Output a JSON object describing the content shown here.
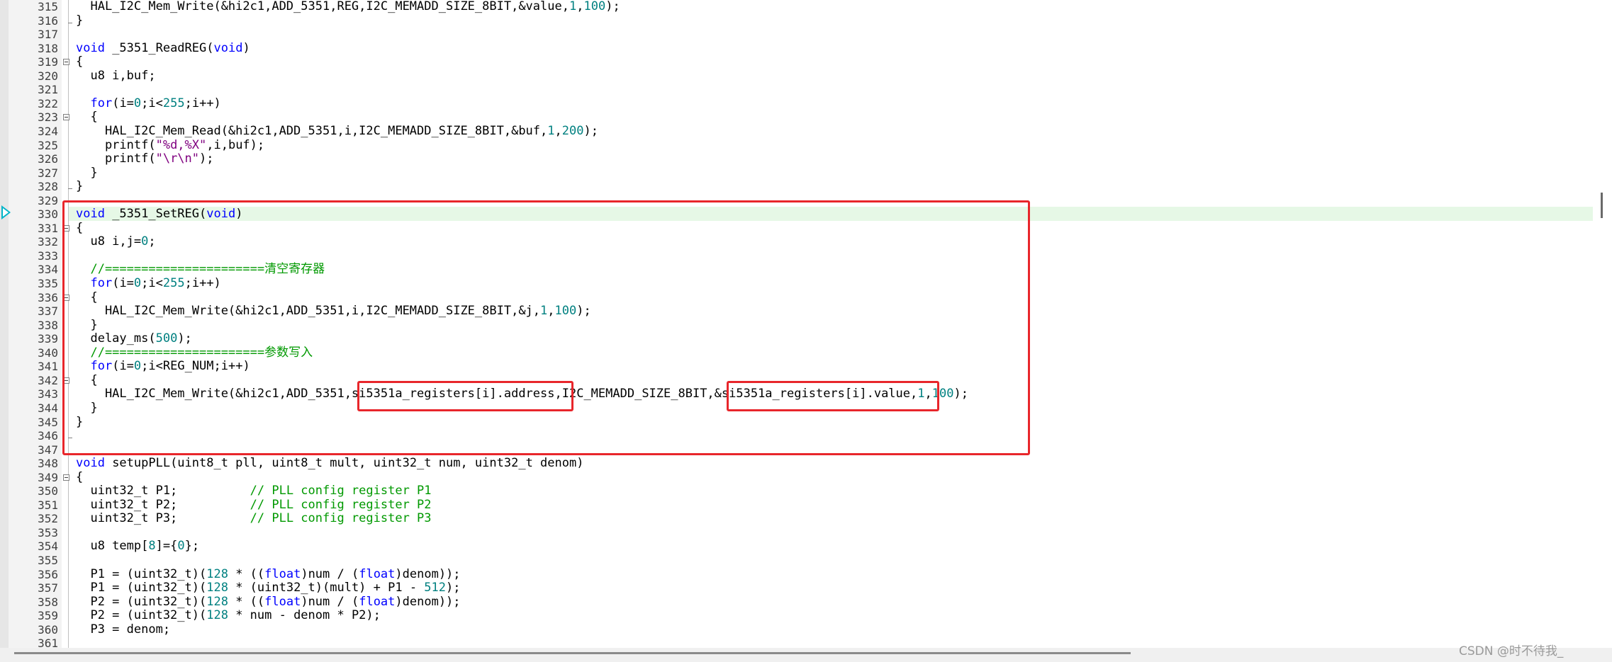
{
  "editor": {
    "colors": {
      "current_line": "#e6f8e6",
      "highlight_box": "#e8262b",
      "keyword": "#0000ff",
      "number": "#008080",
      "comment": "#009900",
      "string": "#800080"
    },
    "line_numbers": [
      "315",
      "316",
      "317",
      "318",
      "319",
      "320",
      "321",
      "322",
      "323",
      "324",
      "325",
      "326",
      "327",
      "328",
      "329",
      "330",
      "331",
      "332",
      "333",
      "334",
      "335",
      "336",
      "337",
      "338",
      "339",
      "340",
      "341",
      "342",
      "343",
      "344",
      "345",
      "346",
      "347",
      "348",
      "349",
      "350",
      "351",
      "352",
      "353",
      "354",
      "355",
      "356",
      "357",
      "358",
      "359",
      "360",
      "361"
    ],
    "lines": [
      [
        {
          "t": "  HAL_I2C_Mem_Write(&hi2c1,ADD_5351,REG,I2C_MEMADD_SIZE_8BIT,&value,"
        },
        {
          "t": "1",
          "c": "num"
        },
        {
          "t": ","
        },
        {
          "t": "100",
          "c": "num"
        },
        {
          "t": ");"
        }
      ],
      [
        {
          "t": "}"
        }
      ],
      [],
      [
        {
          "t": "void",
          "c": "kw"
        },
        {
          "t": " _5351_ReadREG("
        },
        {
          "t": "void",
          "c": "kw"
        },
        {
          "t": ")"
        }
      ],
      [
        {
          "t": "{"
        }
      ],
      [
        {
          "t": "  u8 i,buf;"
        }
      ],
      [],
      [
        {
          "t": "  "
        },
        {
          "t": "for",
          "c": "kw"
        },
        {
          "t": "(i="
        },
        {
          "t": "0",
          "c": "num"
        },
        {
          "t": ";i<"
        },
        {
          "t": "255",
          "c": "num"
        },
        {
          "t": ";i++)"
        }
      ],
      [
        {
          "t": "  {"
        }
      ],
      [
        {
          "t": "    HAL_I2C_Mem_Read(&hi2c1,ADD_5351,i,I2C_MEMADD_SIZE_8BIT,&buf,"
        },
        {
          "t": "1",
          "c": "num"
        },
        {
          "t": ","
        },
        {
          "t": "200",
          "c": "num"
        },
        {
          "t": ");"
        }
      ],
      [
        {
          "t": "    printf("
        },
        {
          "t": "\"%d,%X\"",
          "c": "str"
        },
        {
          "t": ",i,buf);"
        }
      ],
      [
        {
          "t": "    printf("
        },
        {
          "t": "\"\\r\\n\"",
          "c": "str"
        },
        {
          "t": ");"
        }
      ],
      [
        {
          "t": "  }"
        }
      ],
      [
        {
          "t": "}"
        }
      ],
      [],
      [
        {
          "t": "void",
          "c": "kw"
        },
        {
          "t": " _5351_SetREG("
        },
        {
          "t": "void",
          "c": "kw"
        },
        {
          "t": ")"
        }
      ],
      [
        {
          "t": "{"
        }
      ],
      [
        {
          "t": "  u8 i,j="
        },
        {
          "t": "0",
          "c": "num"
        },
        {
          "t": ";"
        }
      ],
      [],
      [
        {
          "t": "  //======================清空寄存器",
          "c": "cm"
        }
      ],
      [
        {
          "t": "  "
        },
        {
          "t": "for",
          "c": "kw"
        },
        {
          "t": "(i="
        },
        {
          "t": "0",
          "c": "num"
        },
        {
          "t": ";i<"
        },
        {
          "t": "255",
          "c": "num"
        },
        {
          "t": ";i++)"
        }
      ],
      [
        {
          "t": "  {"
        }
      ],
      [
        {
          "t": "    HAL_I2C_Mem_Write(&hi2c1,ADD_5351,i,I2C_MEMADD_SIZE_8BIT,&j,"
        },
        {
          "t": "1",
          "c": "num"
        },
        {
          "t": ","
        },
        {
          "t": "100",
          "c": "num"
        },
        {
          "t": ");"
        }
      ],
      [
        {
          "t": "  }"
        }
      ],
      [
        {
          "t": "  delay_ms("
        },
        {
          "t": "500",
          "c": "num"
        },
        {
          "t": ");"
        }
      ],
      [
        {
          "t": "  //======================参数写入",
          "c": "cm"
        }
      ],
      [
        {
          "t": "  "
        },
        {
          "t": "for",
          "c": "kw"
        },
        {
          "t": "(i="
        },
        {
          "t": "0",
          "c": "num"
        },
        {
          "t": ";i<REG_NUM;i++)"
        }
      ],
      [
        {
          "t": "  {"
        }
      ],
      [
        {
          "t": "    HAL_I2C_Mem_Write(&hi2c1,ADD_5351,si5351a_registers[i].address,I2C_MEMADD_SIZE_8BIT,&si5351a_registers[i].value,"
        },
        {
          "t": "1",
          "c": "num"
        },
        {
          "t": ","
        },
        {
          "t": "100",
          "c": "num"
        },
        {
          "t": ");"
        }
      ],
      [
        {
          "t": "  }"
        }
      ],
      [
        {
          "t": "}"
        }
      ],
      [],
      [],
      [
        {
          "t": "void",
          "c": "kw"
        },
        {
          "t": " setupPLL(uint8_t pll, uint8_t mult, uint32_t num, uint32_t denom)"
        }
      ],
      [
        {
          "t": "{"
        }
      ],
      [
        {
          "t": "  uint32_t P1;          "
        },
        {
          "t": "// PLL config register P1",
          "c": "cm"
        }
      ],
      [
        {
          "t": "  uint32_t P2;          "
        },
        {
          "t": "// PLL config register P2",
          "c": "cm"
        }
      ],
      [
        {
          "t": "  uint32_t P3;          "
        },
        {
          "t": "// PLL config register P3",
          "c": "cm"
        }
      ],
      [],
      [
        {
          "t": "  u8 temp["
        },
        {
          "t": "8",
          "c": "num"
        },
        {
          "t": "]={"
        },
        {
          "t": "0",
          "c": "num"
        },
        {
          "t": "};"
        }
      ],
      [],
      [
        {
          "t": "  P1 = (uint32_t)("
        },
        {
          "t": "128",
          "c": "num"
        },
        {
          "t": " * (("
        },
        {
          "t": "float",
          "c": "kw"
        },
        {
          "t": ")num / ("
        },
        {
          "t": "float",
          "c": "kw"
        },
        {
          "t": ")denom));"
        }
      ],
      [
        {
          "t": "  P1 = (uint32_t)("
        },
        {
          "t": "128",
          "c": "num"
        },
        {
          "t": " * (uint32_t)(mult) + P1 - "
        },
        {
          "t": "512",
          "c": "num"
        },
        {
          "t": ");"
        }
      ],
      [
        {
          "t": "  P2 = (uint32_t)("
        },
        {
          "t": "128",
          "c": "num"
        },
        {
          "t": " * (("
        },
        {
          "t": "float",
          "c": "kw"
        },
        {
          "t": ")num / ("
        },
        {
          "t": "float",
          "c": "kw"
        },
        {
          "t": ")denom));"
        }
      ],
      [
        {
          "t": "  P2 = (uint32_t)("
        },
        {
          "t": "128",
          "c": "num"
        },
        {
          "t": " * num - denom * P2);"
        }
      ],
      [
        {
          "t": "  P3 = denom;"
        }
      ],
      []
    ]
  },
  "watermark": {
    "text": "CSDN @时不待我_"
  },
  "icons": {
    "execution_marker": "play-arrow-icon",
    "fold_toggle": "fold-minus-icon"
  }
}
